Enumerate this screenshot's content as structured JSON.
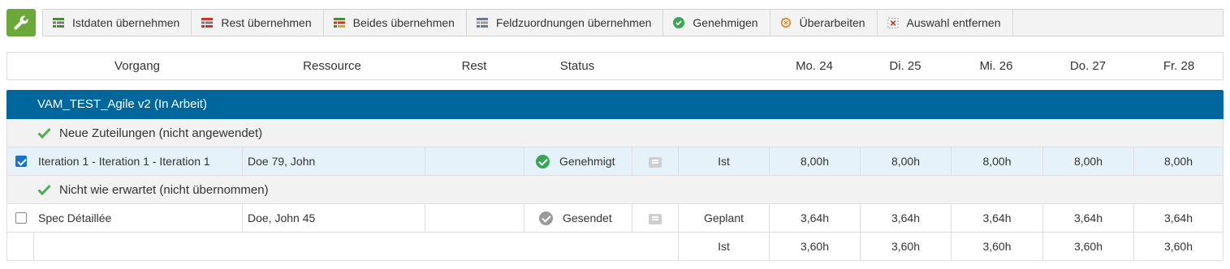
{
  "toolbar": {
    "items": [
      {
        "label": "Istdaten übernehmen",
        "icon": "grid-green-icon"
      },
      {
        "label": "Rest übernehmen",
        "icon": "grid-red-icon"
      },
      {
        "label": "Beides übernehmen",
        "icon": "grid-mixed-icon"
      },
      {
        "label": "Feldzuordnungen übernehmen",
        "icon": "grid-gray-icon"
      },
      {
        "label": "Genehmigen",
        "icon": "approve-check-icon"
      },
      {
        "label": "Überarbeiten",
        "icon": "revise-icon"
      },
      {
        "label": "Auswahl entfernen",
        "icon": "remove-selection-icon"
      }
    ]
  },
  "header": {
    "vorgang": "Vorgang",
    "ressource": "Ressource",
    "rest": "Rest",
    "status": "Status",
    "days": [
      "Mo. 24",
      "Di. 25",
      "Mi. 26",
      "Do. 27",
      "Fr. 28"
    ]
  },
  "project": {
    "title": "VAM_TEST_Agile v2 (In Arbeit)"
  },
  "groups": [
    {
      "title": "Neue Zuteilungen (nicht angewendet)",
      "rows": [
        {
          "checked": true,
          "vorgang": "Iteration 1 - Iteration 1 - Iteration 1",
          "ressource": "Doe 79, John",
          "rest": "",
          "status": "Genehmigt",
          "status_color": "#3aa655",
          "lines": [
            {
              "type": "Ist",
              "values": [
                "8,00h",
                "8,00h",
                "8,00h",
                "8,00h",
                "8,00h"
              ]
            }
          ]
        }
      ]
    },
    {
      "title": "Nicht wie erwartet (nicht übernommen)",
      "rows": [
        {
          "checked": false,
          "vorgang": "Spec Détaillée",
          "ressource": "Doe, John 45",
          "rest": "",
          "status": "Gesendet",
          "status_color": "#9a9a9a",
          "lines": [
            {
              "type": "Geplant",
              "values": [
                "3,64h",
                "3,64h",
                "3,64h",
                "3,64h",
                "3,64h"
              ]
            },
            {
              "type": "Ist",
              "values": [
                "3,60h",
                "3,60h",
                "3,60h",
                "3,60h",
                "3,60h"
              ]
            }
          ]
        }
      ]
    }
  ],
  "colors": {
    "accent": "#00679c",
    "badge": "#6aa83a",
    "check_green": "#4caf50",
    "selected_row": "#e5f2f9"
  }
}
